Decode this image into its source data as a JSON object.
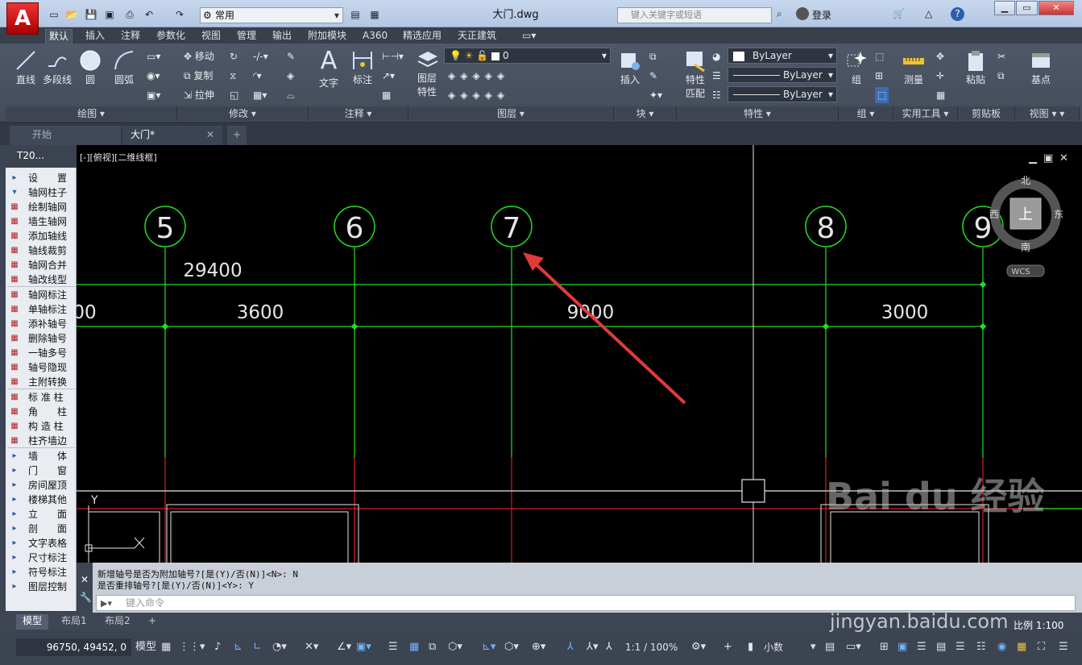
{
  "app": {
    "logo_letter": "A",
    "title": "大门.dwg"
  },
  "quick_access": {
    "workspace": "常用",
    "icons": [
      "new-icon",
      "open-icon",
      "save-icon",
      "saveas-icon",
      "print-icon",
      "undo-icon",
      "redo-icon"
    ]
  },
  "search": {
    "placeholder": "键入关键字或短语"
  },
  "user": {
    "login": "登录"
  },
  "ribbon_tabs": [
    "默认",
    "插入",
    "注释",
    "参数化",
    "视图",
    "管理",
    "输出",
    "附加模块",
    "A360",
    "精选应用",
    "天正建筑"
  ],
  "ribbon": {
    "draw": {
      "title": "绘图",
      "line": "直线",
      "polyline": "多段线",
      "circle": "圆",
      "arc": "圆弧"
    },
    "modify": {
      "title": "修改",
      "move": "移动",
      "copy": "复制",
      "stretch": "拉伸"
    },
    "annotation": {
      "title": "注释",
      "text": "文字",
      "dim": "标注"
    },
    "layers": {
      "title": "图层",
      "layer_props_1": "图层",
      "layer_props_2": "特性",
      "current_layer": "0"
    },
    "block": {
      "title": "块",
      "insert": "插入"
    },
    "properties": {
      "title": "特性",
      "match_1": "特性",
      "match_2": "匹配",
      "color": "ByLayer",
      "linetype": "ByLayer",
      "lineweight": "ByLayer"
    },
    "groups": {
      "title": "组",
      "group": "组"
    },
    "utilities": {
      "title": "实用工具",
      "measure": "测量"
    },
    "clipboard": {
      "title": "剪贴板",
      "paste": "粘贴"
    },
    "view": {
      "title": "视图",
      "base": "基点"
    }
  },
  "doc_tabs": [
    {
      "label": "开始"
    },
    {
      "label": "大门*"
    }
  ],
  "palette": {
    "header": "T20...",
    "items": [
      {
        "label": "设　　置",
        "type": "section"
      },
      {
        "label": "轴网柱子",
        "type": "section-open"
      },
      {
        "label": "绘制轴网",
        "type": "cmd"
      },
      {
        "label": "墙生轴网",
        "type": "cmd"
      },
      {
        "label": "添加轴线",
        "type": "cmd"
      },
      {
        "label": "轴线裁剪",
        "type": "cmd"
      },
      {
        "label": "轴网合并",
        "type": "cmd"
      },
      {
        "label": "轴改线型",
        "type": "cmd"
      },
      {
        "label": "轴网标注",
        "type": "cmd"
      },
      {
        "label": "单轴标注",
        "type": "cmd"
      },
      {
        "label": "添补轴号",
        "type": "cmd"
      },
      {
        "label": "删除轴号",
        "type": "cmd"
      },
      {
        "label": "一轴多号",
        "type": "cmd"
      },
      {
        "label": "轴号隐现",
        "type": "cmd"
      },
      {
        "label": "主附转换",
        "type": "cmd"
      },
      {
        "label": "标 准 柱",
        "type": "cmd"
      },
      {
        "label": "角　　柱",
        "type": "cmd"
      },
      {
        "label": "构 造 柱",
        "type": "cmd"
      },
      {
        "label": "柱齐墙边",
        "type": "cmd"
      },
      {
        "label": "墙　　体",
        "type": "section"
      },
      {
        "label": "门　　窗",
        "type": "section"
      },
      {
        "label": "房间屋顶",
        "type": "section"
      },
      {
        "label": "楼梯其他",
        "type": "section"
      },
      {
        "label": "立　　面",
        "type": "section"
      },
      {
        "label": "剖　　面",
        "type": "section"
      },
      {
        "label": "文字表格",
        "type": "section"
      },
      {
        "label": "尺寸标注",
        "type": "section"
      },
      {
        "label": "符号标注",
        "type": "section"
      },
      {
        "label": "图层控制",
        "type": "section"
      }
    ]
  },
  "viewport": {
    "label": "[-][俯视][二维线框]",
    "axis_numbers": [
      "5",
      "6",
      "7",
      "8",
      "9"
    ],
    "total_dim": "29400",
    "dims": [
      "00",
      "3600",
      "9000",
      "3000"
    ],
    "viewcube": {
      "north": "北",
      "south": "南",
      "east": "东",
      "west": "西",
      "top": "上",
      "wcs": "WCS"
    },
    "ucs_y": "Y",
    "colors": {
      "axis": "#22dd22",
      "red": "#d21f1f",
      "white": "#e6e6e6",
      "arrow": "#e03a3a"
    }
  },
  "command": {
    "history": [
      "新增轴号是否为附加轴号?[是(Y)/否(N)]<N>: N",
      "是否重排轴号?[是(Y)/否(N)]<Y>: Y"
    ],
    "placeholder": "键入命令"
  },
  "layout_tabs": [
    "模型",
    "布局1",
    "布局2"
  ],
  "status": {
    "coords": "96750, 49452, 0",
    "model": "模型",
    "scale_text": "1:1 / 100%",
    "units": "小数",
    "annotation_scale": "比例 1:100"
  },
  "watermark": {
    "brand": "Bai du 经验",
    "url": "jingyan.baidu.com"
  }
}
